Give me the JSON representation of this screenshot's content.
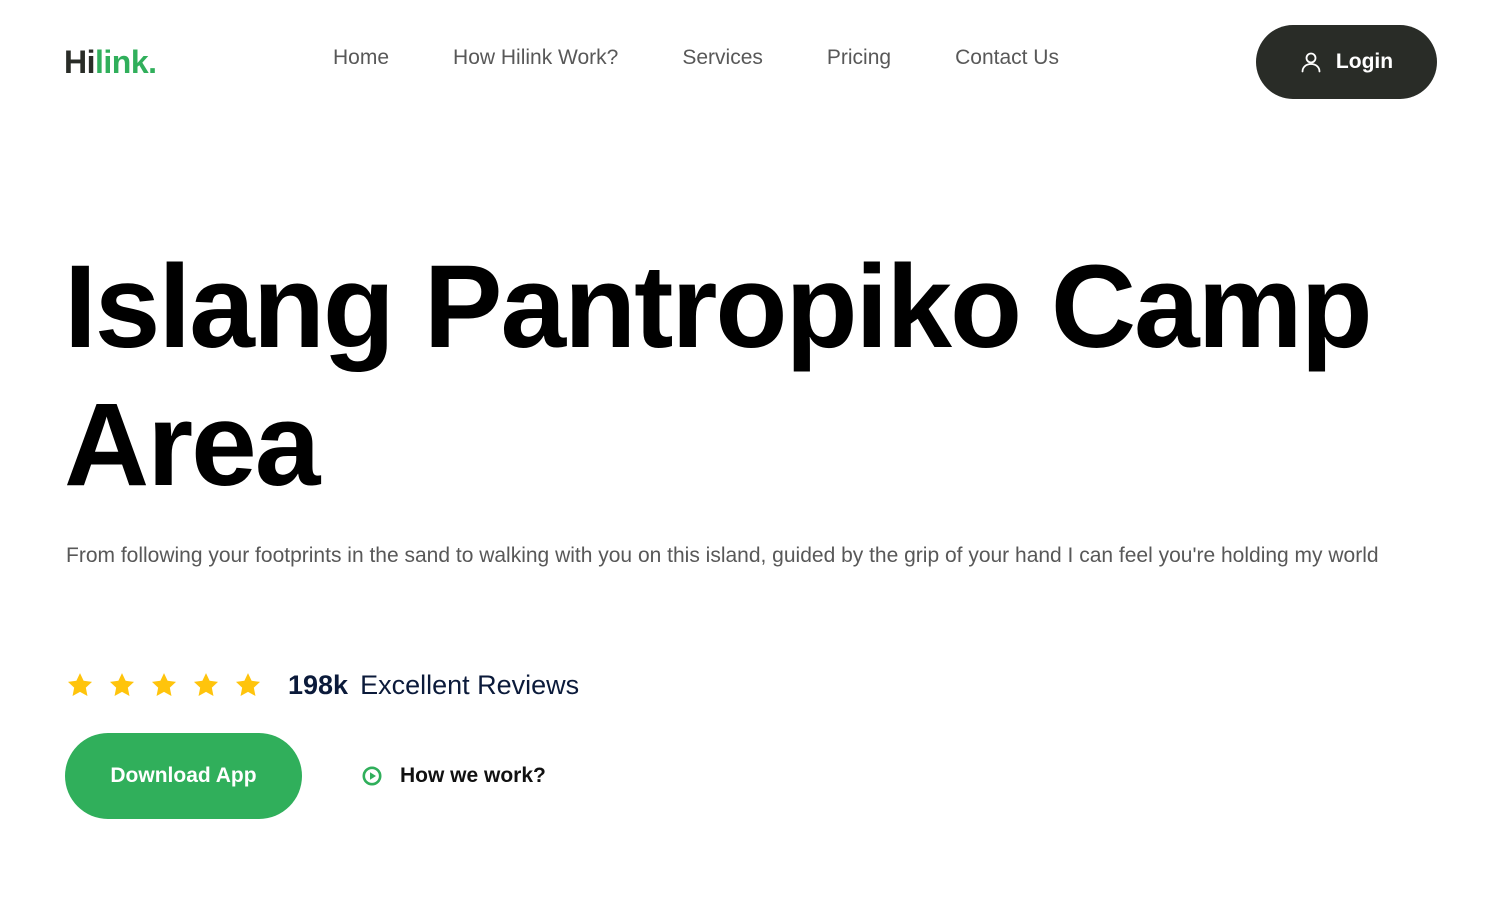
{
  "header": {
    "logo_hi": "Hi",
    "logo_link": "link.",
    "nav": [
      "Home",
      "How Hilink Work?",
      "Services",
      "Pricing",
      "Contact Us"
    ],
    "login_label": "Login"
  },
  "hero": {
    "title_line1": "Islang Pantropiko Camp",
    "title_line2": "Area",
    "description": "From following your footprints in the sand to walking with you on this island, guided by the grip of your hand I can feel you're holding my world",
    "rating": {
      "stars": 5,
      "count": "198k",
      "label": "Excellent Reviews"
    },
    "download_label": "Download App",
    "how_label": "How we work?"
  },
  "colors": {
    "brand_green": "#30af5b",
    "dark": "#292c27",
    "star": "#ffc40c"
  },
  "icons": {
    "login": "user-icon",
    "star": "star-icon",
    "how": "play-circle-icon"
  }
}
